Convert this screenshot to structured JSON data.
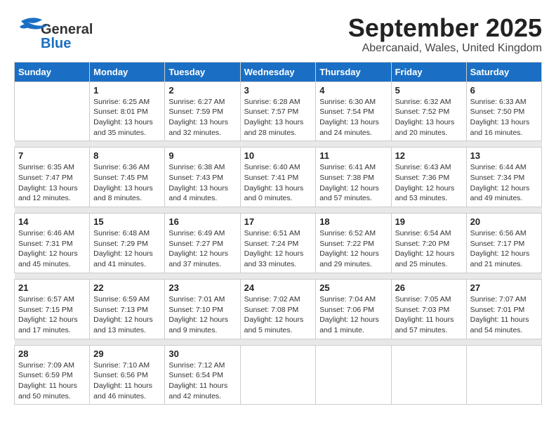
{
  "header": {
    "logo_general": "General",
    "logo_blue": "Blue",
    "month": "September 2025",
    "location": "Abercanaid, Wales, United Kingdom"
  },
  "weekdays": [
    "Sunday",
    "Monday",
    "Tuesday",
    "Wednesday",
    "Thursday",
    "Friday",
    "Saturday"
  ],
  "weeks": [
    [
      {
        "day": "",
        "sunrise": "",
        "sunset": "",
        "daylight": ""
      },
      {
        "day": "1",
        "sunrise": "Sunrise: 6:25 AM",
        "sunset": "Sunset: 8:01 PM",
        "daylight": "Daylight: 13 hours and 35 minutes."
      },
      {
        "day": "2",
        "sunrise": "Sunrise: 6:27 AM",
        "sunset": "Sunset: 7:59 PM",
        "daylight": "Daylight: 13 hours and 32 minutes."
      },
      {
        "day": "3",
        "sunrise": "Sunrise: 6:28 AM",
        "sunset": "Sunset: 7:57 PM",
        "daylight": "Daylight: 13 hours and 28 minutes."
      },
      {
        "day": "4",
        "sunrise": "Sunrise: 6:30 AM",
        "sunset": "Sunset: 7:54 PM",
        "daylight": "Daylight: 13 hours and 24 minutes."
      },
      {
        "day": "5",
        "sunrise": "Sunrise: 6:32 AM",
        "sunset": "Sunset: 7:52 PM",
        "daylight": "Daylight: 13 hours and 20 minutes."
      },
      {
        "day": "6",
        "sunrise": "Sunrise: 6:33 AM",
        "sunset": "Sunset: 7:50 PM",
        "daylight": "Daylight: 13 hours and 16 minutes."
      }
    ],
    [
      {
        "day": "7",
        "sunrise": "Sunrise: 6:35 AM",
        "sunset": "Sunset: 7:47 PM",
        "daylight": "Daylight: 13 hours and 12 minutes."
      },
      {
        "day": "8",
        "sunrise": "Sunrise: 6:36 AM",
        "sunset": "Sunset: 7:45 PM",
        "daylight": "Daylight: 13 hours and 8 minutes."
      },
      {
        "day": "9",
        "sunrise": "Sunrise: 6:38 AM",
        "sunset": "Sunset: 7:43 PM",
        "daylight": "Daylight: 13 hours and 4 minutes."
      },
      {
        "day": "10",
        "sunrise": "Sunrise: 6:40 AM",
        "sunset": "Sunset: 7:41 PM",
        "daylight": "Daylight: 13 hours and 0 minutes."
      },
      {
        "day": "11",
        "sunrise": "Sunrise: 6:41 AM",
        "sunset": "Sunset: 7:38 PM",
        "daylight": "Daylight: 12 hours and 57 minutes."
      },
      {
        "day": "12",
        "sunrise": "Sunrise: 6:43 AM",
        "sunset": "Sunset: 7:36 PM",
        "daylight": "Daylight: 12 hours and 53 minutes."
      },
      {
        "day": "13",
        "sunrise": "Sunrise: 6:44 AM",
        "sunset": "Sunset: 7:34 PM",
        "daylight": "Daylight: 12 hours and 49 minutes."
      }
    ],
    [
      {
        "day": "14",
        "sunrise": "Sunrise: 6:46 AM",
        "sunset": "Sunset: 7:31 PM",
        "daylight": "Daylight: 12 hours and 45 minutes."
      },
      {
        "day": "15",
        "sunrise": "Sunrise: 6:48 AM",
        "sunset": "Sunset: 7:29 PM",
        "daylight": "Daylight: 12 hours and 41 minutes."
      },
      {
        "day": "16",
        "sunrise": "Sunrise: 6:49 AM",
        "sunset": "Sunset: 7:27 PM",
        "daylight": "Daylight: 12 hours and 37 minutes."
      },
      {
        "day": "17",
        "sunrise": "Sunrise: 6:51 AM",
        "sunset": "Sunset: 7:24 PM",
        "daylight": "Daylight: 12 hours and 33 minutes."
      },
      {
        "day": "18",
        "sunrise": "Sunrise: 6:52 AM",
        "sunset": "Sunset: 7:22 PM",
        "daylight": "Daylight: 12 hours and 29 minutes."
      },
      {
        "day": "19",
        "sunrise": "Sunrise: 6:54 AM",
        "sunset": "Sunset: 7:20 PM",
        "daylight": "Daylight: 12 hours and 25 minutes."
      },
      {
        "day": "20",
        "sunrise": "Sunrise: 6:56 AM",
        "sunset": "Sunset: 7:17 PM",
        "daylight": "Daylight: 12 hours and 21 minutes."
      }
    ],
    [
      {
        "day": "21",
        "sunrise": "Sunrise: 6:57 AM",
        "sunset": "Sunset: 7:15 PM",
        "daylight": "Daylight: 12 hours and 17 minutes."
      },
      {
        "day": "22",
        "sunrise": "Sunrise: 6:59 AM",
        "sunset": "Sunset: 7:13 PM",
        "daylight": "Daylight: 12 hours and 13 minutes."
      },
      {
        "day": "23",
        "sunrise": "Sunrise: 7:01 AM",
        "sunset": "Sunset: 7:10 PM",
        "daylight": "Daylight: 12 hours and 9 minutes."
      },
      {
        "day": "24",
        "sunrise": "Sunrise: 7:02 AM",
        "sunset": "Sunset: 7:08 PM",
        "daylight": "Daylight: 12 hours and 5 minutes."
      },
      {
        "day": "25",
        "sunrise": "Sunrise: 7:04 AM",
        "sunset": "Sunset: 7:06 PM",
        "daylight": "Daylight: 12 hours and 1 minute."
      },
      {
        "day": "26",
        "sunrise": "Sunrise: 7:05 AM",
        "sunset": "Sunset: 7:03 PM",
        "daylight": "Daylight: 11 hours and 57 minutes."
      },
      {
        "day": "27",
        "sunrise": "Sunrise: 7:07 AM",
        "sunset": "Sunset: 7:01 PM",
        "daylight": "Daylight: 11 hours and 54 minutes."
      }
    ],
    [
      {
        "day": "28",
        "sunrise": "Sunrise: 7:09 AM",
        "sunset": "Sunset: 6:59 PM",
        "daylight": "Daylight: 11 hours and 50 minutes."
      },
      {
        "day": "29",
        "sunrise": "Sunrise: 7:10 AM",
        "sunset": "Sunset: 6:56 PM",
        "daylight": "Daylight: 11 hours and 46 minutes."
      },
      {
        "day": "30",
        "sunrise": "Sunrise: 7:12 AM",
        "sunset": "Sunset: 6:54 PM",
        "daylight": "Daylight: 11 hours and 42 minutes."
      },
      {
        "day": "",
        "sunrise": "",
        "sunset": "",
        "daylight": ""
      },
      {
        "day": "",
        "sunrise": "",
        "sunset": "",
        "daylight": ""
      },
      {
        "day": "",
        "sunrise": "",
        "sunset": "",
        "daylight": ""
      },
      {
        "day": "",
        "sunrise": "",
        "sunset": "",
        "daylight": ""
      }
    ]
  ]
}
